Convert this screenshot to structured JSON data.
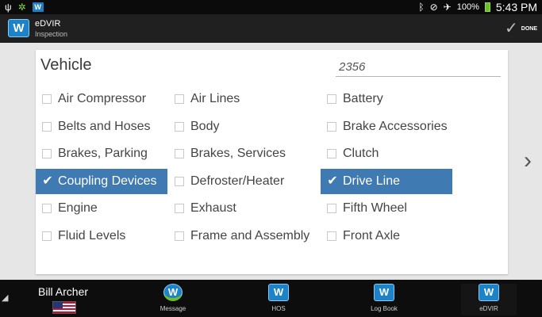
{
  "status_bar": {
    "battery": "100%",
    "time": "5:43 PM",
    "icons": [
      "usb-icon",
      "settings-icon",
      "app-w-icon",
      "bluetooth-icon",
      "mute-icon",
      "airplane-icon",
      "battery-icon"
    ]
  },
  "app": {
    "title": "eDVIR",
    "subtitle": "Inspection",
    "logo": "W",
    "done_label": "DONE"
  },
  "form": {
    "title": "Vehicle",
    "vehicle_number": "2356",
    "accent": "#3f7ab2"
  },
  "checklist": [
    {
      "label": "Air Compressor",
      "checked": false
    },
    {
      "label": "Air Lines",
      "checked": false
    },
    {
      "label": "Battery",
      "checked": false
    },
    {
      "label": "Belts and Hoses",
      "checked": false
    },
    {
      "label": "Body",
      "checked": false
    },
    {
      "label": "Brake Accessories",
      "checked": false
    },
    {
      "label": "Brakes, Parking",
      "checked": false
    },
    {
      "label": "Brakes, Services",
      "checked": false
    },
    {
      "label": "Clutch",
      "checked": false
    },
    {
      "label": "Coupling Devices",
      "checked": true
    },
    {
      "label": "Defroster/Heater",
      "checked": false
    },
    {
      "label": "Drive Line",
      "checked": true
    },
    {
      "label": "Engine",
      "checked": false
    },
    {
      "label": "Exhaust",
      "checked": false
    },
    {
      "label": "Fifth Wheel",
      "checked": false
    },
    {
      "label": "Fluid Levels",
      "checked": false
    },
    {
      "label": "Frame and Assembly",
      "checked": false
    },
    {
      "label": "Front Axle",
      "checked": false
    }
  ],
  "bottom_nav": {
    "user_name": "Bill Archer",
    "items": [
      {
        "label": "Message",
        "icon": "message-icon"
      },
      {
        "label": "HOS",
        "icon": "hos-icon"
      },
      {
        "label": "Log Book",
        "icon": "logbook-icon"
      },
      {
        "label": "eDVIR",
        "icon": "edvir-icon"
      }
    ]
  }
}
